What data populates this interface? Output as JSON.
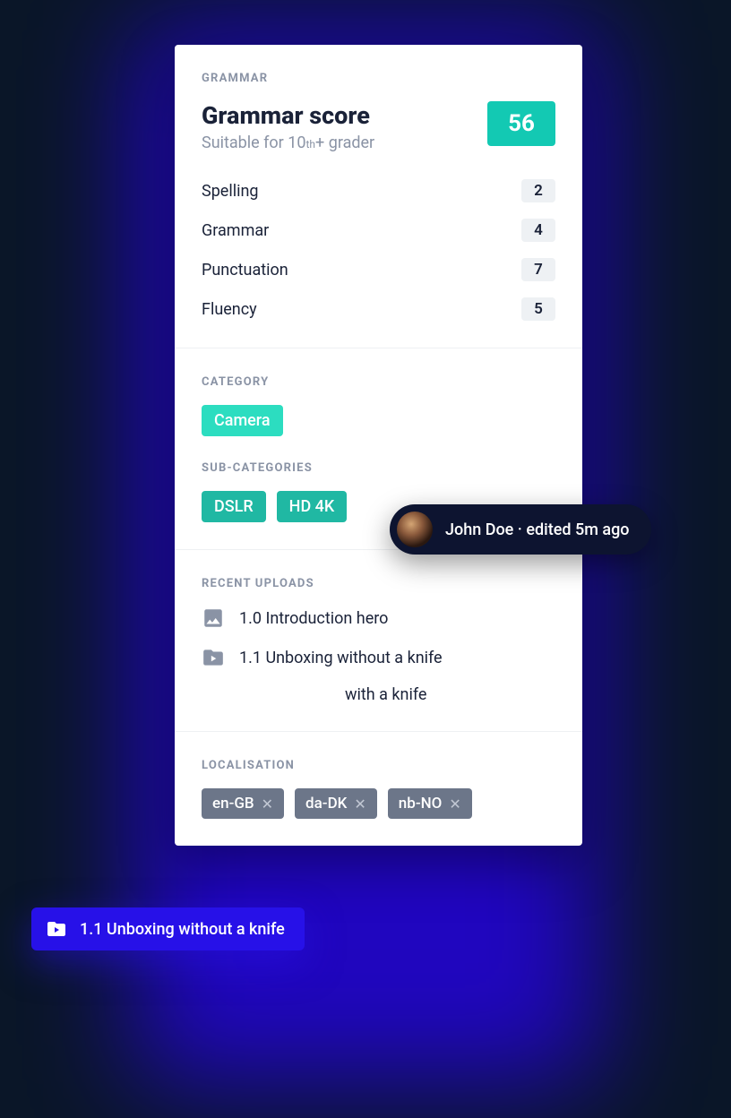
{
  "grammar": {
    "eyebrow": "GRAMMAR",
    "title": "Grammar score",
    "subtitle_pre": "Suitable for 10",
    "subtitle_ord": "th",
    "subtitle_post": "+ grader",
    "score": "56",
    "metrics": [
      {
        "label": "Spelling",
        "value": "2"
      },
      {
        "label": "Grammar",
        "value": "4"
      },
      {
        "label": "Punctuation",
        "value": "7"
      },
      {
        "label": "Fluency",
        "value": "5"
      }
    ]
  },
  "category": {
    "eyebrow": "CATEGORY",
    "tag": "Camera",
    "sub_eyebrow": "SUB-CATEGORIES",
    "subs": [
      "DSLR",
      "HD 4K"
    ]
  },
  "uploads": {
    "eyebrow": "RECENT UPLOADS",
    "items": [
      {
        "icon": "image",
        "text": "1.0 Introduction hero"
      },
      {
        "icon": "video",
        "text": "1.1 Unboxing without a knife"
      },
      {
        "icon": "video",
        "text": "with a knife"
      }
    ]
  },
  "localisation": {
    "eyebrow": "LOCALISATION",
    "tags": [
      "en-GB",
      "da-DK",
      "nb-NO"
    ]
  },
  "user_pill": {
    "name": "John Doe",
    "meta": "edited 5m ago"
  },
  "drag_pill": {
    "text": "1.1 Unboxing without a knife"
  }
}
